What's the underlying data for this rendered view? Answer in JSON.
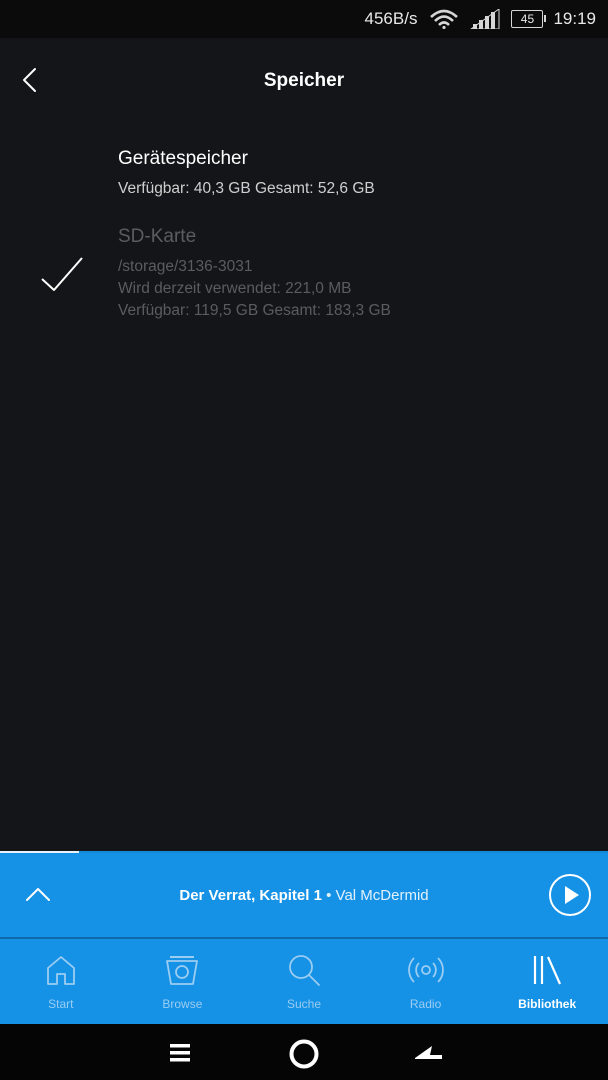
{
  "status_bar": {
    "net_speed": "456B/s",
    "battery": "45",
    "time": "19:19",
    "icons": [
      "wifi-icon",
      "signal-icon",
      "battery-icon"
    ]
  },
  "header": {
    "title": "Speicher",
    "back_icon": "chevron-left-icon"
  },
  "storage": {
    "device": {
      "title": "Gerätespeicher",
      "details": "Verfügbar: 40,3 GB Gesamt: 52,6 GB"
    },
    "sd": {
      "title": "SD-Karte",
      "path": "/storage/3136-3031",
      "in_use": "Wird derzeit verwendet: 221,0 MB",
      "details": "Verfügbar: 119,5 GB Gesamt: 183,3 GB",
      "selected": true
    }
  },
  "now_playing": {
    "title": "Der Verrat, Kapitel 1",
    "separator": " • ",
    "artist": "Val McDermid",
    "progress": 0.13
  },
  "tabs": [
    {
      "label": "Start",
      "icon": "home-icon",
      "active": false
    },
    {
      "label": "Browse",
      "icon": "browse-icon",
      "active": false
    },
    {
      "label": "Suche",
      "icon": "search-icon",
      "active": false
    },
    {
      "label": "Radio",
      "icon": "radio-icon",
      "active": false
    },
    {
      "label": "Bibliothek",
      "icon": "library-icon",
      "active": true
    }
  ],
  "colors": {
    "background": "#141518",
    "accent": "#1591e6",
    "text_primary": "#ffffff",
    "text_disabled": "#5b5c60"
  }
}
